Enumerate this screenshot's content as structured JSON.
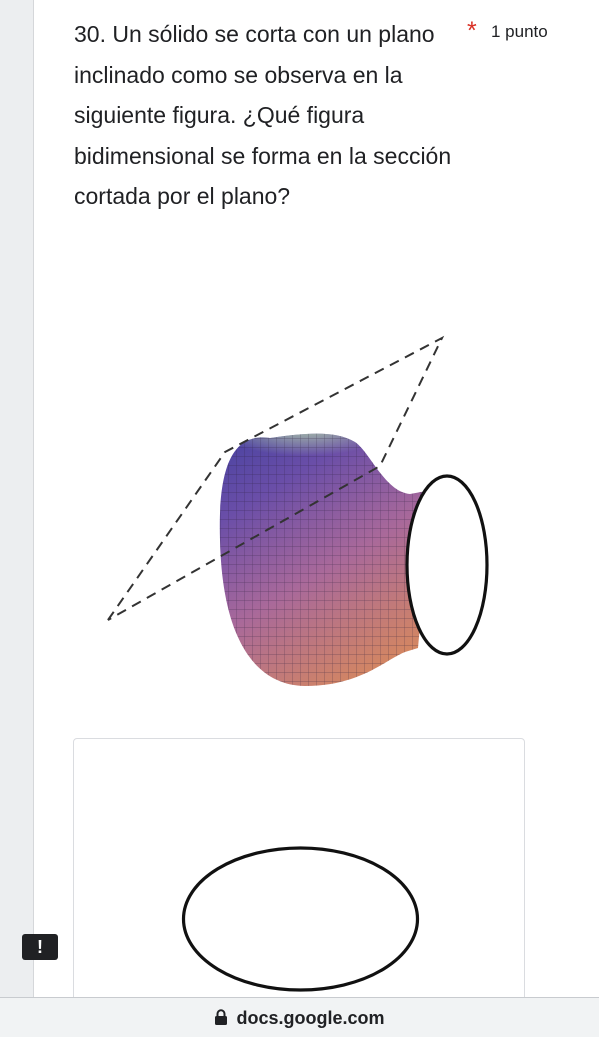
{
  "question": {
    "title": "30. Un sólido se corta con un plano inclinado como se observa en la siguiente figura. ¿Qué figura bidimensional se forma en la sección cortada por el plano?",
    "required_marker": "*",
    "points": "1 punto"
  },
  "figure": {
    "icon": "solid-cut-by-plane-figure"
  },
  "option": {
    "icon": "ellipse-option-shape"
  },
  "alert": {
    "label": "!"
  },
  "browser": {
    "url": "docs.google.com",
    "lock_icon": "lock-icon"
  }
}
